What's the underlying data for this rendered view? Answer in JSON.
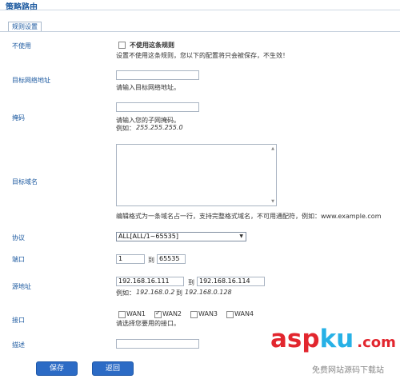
{
  "page": {
    "title": "策略路由",
    "tab": "规则设置"
  },
  "form": {
    "disable": {
      "label": "不使用",
      "checkbox_label": "不使用这条规则",
      "checked": false,
      "hint": "设置不使用这条规则，您以下的配置将只会被保存，不生效！"
    },
    "target_ip": {
      "label": "目标网络地址",
      "value": "",
      "hint": "请输入目标网络地址。"
    },
    "mask": {
      "label": "掩码",
      "value": "",
      "hint": "请输入您的子网掩码。",
      "example_prefix": "例如：",
      "example_value": "255.255.255.0"
    },
    "domain": {
      "label": "目标域名",
      "value": "",
      "hint": "编辑格式为一条域名占一行，支持完整格式域名，不可用通配符，例如：www.example.com"
    },
    "protocol": {
      "label": "协议",
      "selected": "ALL[ALL/1~65535]"
    },
    "port": {
      "label": "端口",
      "from": "1",
      "to_label": "到",
      "to": "65535"
    },
    "source": {
      "label": "源地址",
      "from": "192.168.16.111",
      "to_label": "到",
      "to": "192.168.16.114",
      "example_prefix": "例如：",
      "example_from": "192.168.0.2",
      "example_to_label": "到",
      "example_to": "192.168.0.128"
    },
    "interface": {
      "label": "接口",
      "options": [
        {
          "name": "WAN1",
          "checked": false
        },
        {
          "name": "WAN2",
          "checked": true
        },
        {
          "name": "WAN3",
          "checked": false
        },
        {
          "name": "WAN4",
          "checked": false
        }
      ],
      "hint": "请选择您要用的接口。"
    },
    "description": {
      "label": "描述",
      "value": ""
    }
  },
  "buttons": {
    "save": "保存",
    "back": "返回"
  },
  "watermark": {
    "asp": "asp",
    "ku": "ku",
    "com": ".com",
    "subtitle": "免费网站源码下载站"
  },
  "colors": {
    "accent": "#1d5aa0",
    "button": "#2c6bc5"
  }
}
